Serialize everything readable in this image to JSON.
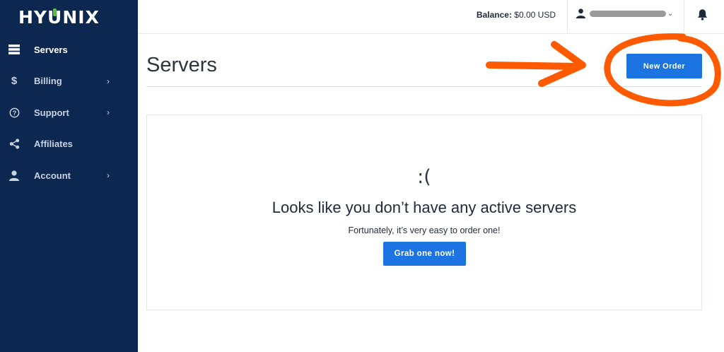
{
  "brand": {
    "logo_text_1": "HY",
    "logo_text_o": "U",
    "logo_text_2": "NIX"
  },
  "sidebar": {
    "items": [
      {
        "label": "Servers",
        "icon": "server-icon",
        "active": true,
        "has_chevron": false
      },
      {
        "label": "Billing",
        "icon": "dollar-icon",
        "active": false,
        "has_chevron": true
      },
      {
        "label": "Support",
        "icon": "question-circle-icon",
        "active": false,
        "has_chevron": true
      },
      {
        "label": "Affiliates",
        "icon": "share-icon",
        "active": false,
        "has_chevron": false
      },
      {
        "label": "Account",
        "icon": "user-icon",
        "active": false,
        "has_chevron": true
      }
    ]
  },
  "topbar": {
    "balance_label": "Balance:",
    "balance_value": "$0.00 USD",
    "user_icon": "user-icon",
    "notification_icon": "bell-icon"
  },
  "main": {
    "title": "Servers",
    "new_order_label": "New Order",
    "empty_state": {
      "emoticon": ":(",
      "heading": "Looks like you don’t have any active servers",
      "subtext": "Fortunately, it’s very easy to order one!",
      "cta_label": "Grab one now!"
    }
  },
  "colors": {
    "sidebar_bg": "#0c2850",
    "primary_button": "#1b74e2",
    "annotation": "#ff5a00",
    "logo_accent": "#5cbf3e"
  }
}
